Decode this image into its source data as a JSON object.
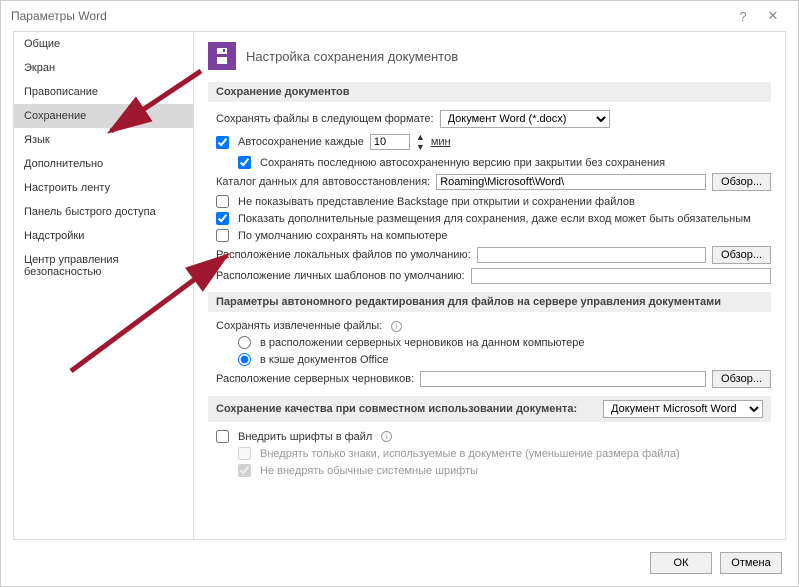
{
  "title": "Параметры Word",
  "titlebar": {
    "help": "?",
    "close": "✕"
  },
  "sidebar": {
    "items": [
      {
        "label": "Общие"
      },
      {
        "label": "Экран"
      },
      {
        "label": "Правописание"
      },
      {
        "label": "Сохранение",
        "selected": true
      },
      {
        "label": "Язык"
      },
      {
        "label": "Дополнительно"
      },
      {
        "label": "Настроить ленту"
      },
      {
        "label": "Панель быстрого доступа"
      },
      {
        "label": "Надстройки"
      },
      {
        "label": "Центр управления безопасностью"
      }
    ]
  },
  "heading": "Настройка сохранения документов",
  "sec1": {
    "title": "Сохранение документов",
    "saveFormatLabel": "Сохранять файлы в следующем формате:",
    "saveFormatValue": "Документ Word (*.docx)",
    "autosaveLabel": "Автосохранение каждые",
    "autosaveValue": "10",
    "autosaveUnit": "мин",
    "keepLastLabel": "Сохранять последнюю автосохраненную версию при закрытии без сохранения",
    "autoRecoverLbl": "Каталог данных для автовосстановления:",
    "autoRecoverPath": "Roaming\\Microsoft\\Word\\",
    "browse": "Обзор...",
    "noBackstage": "Не показывать представление Backstage при открытии и сохранении файлов",
    "extraLocations": "Показать дополнительные размещения для сохранения, даже если вход может быть обязательным",
    "saveLocal": "По умолчанию сохранять на компьютере",
    "localFilesLbl": "Расположение локальных файлов по умолчанию:",
    "templatesLbl": "Расположение личных шаблонов по умолчанию:"
  },
  "sec2": {
    "title": "Параметры автономного редактирования для файлов на сервере управления документами",
    "saveExtracted": "Сохранять извлеченные файлы:",
    "opt1": "в расположении серверных черновиков на данном компьютере",
    "opt2": "в кэше документов Office",
    "draftsLbl": "Расположение серверных черновиков:",
    "browse": "Обзор..."
  },
  "sec3": {
    "title": "Сохранение качества при совместном использовании документа:",
    "docName": "Документ Microsoft Word",
    "embed": "Внедрить шрифты в файл",
    "embedUsed": "Внедрять только знаки, используемые в документе (уменьшение размера файла)",
    "noSystem": "Не внедрять обычные системные шрифты"
  },
  "footer": {
    "ok": "ОК",
    "cancel": "Отмена"
  }
}
